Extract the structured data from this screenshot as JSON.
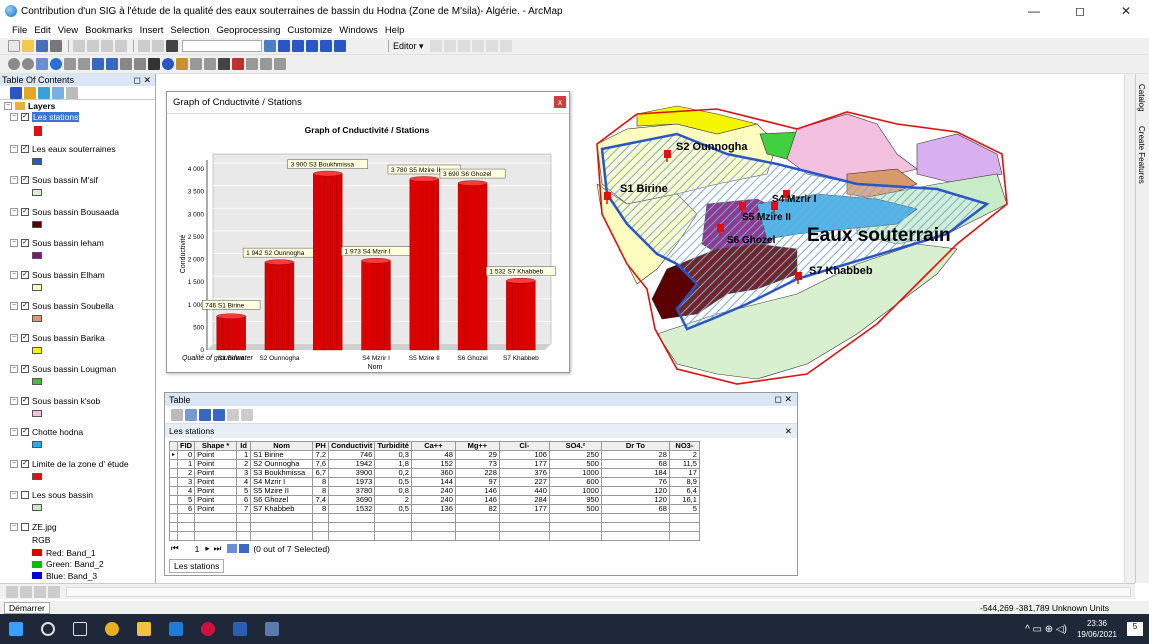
{
  "window": {
    "title": "Contribution d'un SIG à l'étude de la qualité des eaux souterraines de bassin du Hodna (Zone de M'sila)- Algérie. - ArcMap",
    "min": "—",
    "max": "◻",
    "close": "✕"
  },
  "menu": [
    "File",
    "Edit",
    "View",
    "Bookmarks",
    "Insert",
    "Selection",
    "Geoprocessing",
    "Customize",
    "Windows",
    "Help"
  ],
  "editor_label": "Editor ▾",
  "toc": {
    "title": "Table Of Contents",
    "pin": "◻ ✕",
    "root": "Layers",
    "layers": [
      {
        "name": "Les stations",
        "color": "#e01010",
        "checked": true,
        "selected": true
      },
      {
        "name": "Les eaux souterraines",
        "color": "#2a56c6",
        "checked": true
      },
      {
        "name": "Sous bassin M'sif",
        "color": "#d8f0d0",
        "checked": true
      },
      {
        "name": "Sous bassin Bousaada",
        "color": "#5a0000",
        "checked": true
      },
      {
        "name": "Sous bassin leham",
        "color": "#7a1a7a",
        "checked": true
      },
      {
        "name": "Sous bassin Elham",
        "color": "#fdfdc0",
        "checked": true
      },
      {
        "name": "Sous bassin Soubella",
        "color": "#d89a6a",
        "checked": true
      },
      {
        "name": "Sous bassin Barika",
        "color": "#f5f500",
        "checked": true
      },
      {
        "name": "Sous bassin Lougman",
        "color": "#40c040",
        "checked": true
      },
      {
        "name": "Sous bassin k'sob",
        "color": "#f4c0e0",
        "checked": true
      },
      {
        "name": "Chotte hodna",
        "color": "#30a8e0",
        "checked": true
      },
      {
        "name": "Limite de la zone d' étude",
        "color": "#e01010",
        "checked": true
      },
      {
        "name": "Les sous bassin",
        "color": "#c8ecc8",
        "checked": false
      },
      {
        "name": "ZE.jpg",
        "color": "",
        "checked": false
      }
    ],
    "raster": {
      "label": "RGB",
      "bands": [
        {
          "name": "Red:  Band_1",
          "color": "#e00000"
        },
        {
          "name": "Green: Band_2",
          "color": "#00c000"
        },
        {
          "name": "Blue:  Band_3",
          "color": "#0000e0"
        }
      ]
    }
  },
  "graph": {
    "window_title": "Graph of Cnductivité /  Stations",
    "close": "x",
    "footer": "Qualité of groundwater"
  },
  "chart_data": {
    "type": "bar",
    "title": "Graph of Cnductivité /  Stations",
    "xlabel": "Nom",
    "ylabel": "Conductivité",
    "ylim": [
      0,
      4000
    ],
    "yticks": [
      "0",
      "500",
      "1 000",
      "1 500",
      "2 000",
      "2 500",
      "3 000",
      "3 500",
      "4 000"
    ],
    "categories": [
      "S1 Birine",
      "S2 Ounnogha",
      "S3 Boukhmissa",
      "S4 Mzrir I",
      "S5 Mzire II",
      "S6 Ghozel",
      "S7 Khabbeb"
    ],
    "xtick_labels": [
      "S1 Birine",
      "S2 Ounnogha",
      "",
      "S4 Mzrir I",
      "S5 Mzire II",
      "S6 Ghozel",
      "S7 Khabbeb"
    ],
    "values": [
      746,
      1942,
      3900,
      1973,
      3780,
      3690,
      1532
    ],
    "data_labels": [
      "746  S1 Birine",
      "1 942  S2 Ounnogha",
      "3 900  S3 Boukhmissa",
      "1 973  S4 Mzrir I",
      "3 780  S5 Mzire II",
      "3 690  S6 Ghozel",
      "1 532  S7 Khabbeb"
    ],
    "bar_color": "#dd0000",
    "grid": true
  },
  "map": {
    "labels": [
      "S2 Ounnogha",
      "S1 Birine",
      "S4 Mzrir I",
      "S5 Mzire II",
      "S6 Ghozel",
      "Eaux souterrain",
      "S7 Khabbeb"
    ]
  },
  "table": {
    "window_title": "Table",
    "layer_tab": "Les stations",
    "columns": [
      "FID",
      "Shape *",
      "Id",
      "Nom",
      "PH",
      "Conductivit",
      "Turbidité",
      "Ca++",
      "Mg++",
      "Cl-",
      "SO4.²",
      "Dr To",
      "NO3-"
    ],
    "rows": [
      [
        "0",
        "Point",
        "1",
        "S1 Birine",
        "7,2",
        "746",
        "0,3",
        "48",
        "29",
        "106",
        "250",
        "28",
        "2"
      ],
      [
        "1",
        "Point",
        "2",
        "S2 Ounnogha",
        "7,6",
        "1942",
        "1,8",
        "152",
        "73",
        "177",
        "500",
        "68",
        "11,5"
      ],
      [
        "2",
        "Point",
        "3",
        "S3 Boukhmissa",
        "6,7",
        "3900",
        "0,2",
        "360",
        "228",
        "376",
        "1000",
        "184",
        "17"
      ],
      [
        "3",
        "Point",
        "4",
        "S4 Mzrir I",
        "8",
        "1973",
        "0,5",
        "144",
        "97",
        "227",
        "600",
        "76",
        "8,9"
      ],
      [
        "4",
        "Point",
        "5",
        "S5 Mzire II",
        "8",
        "3780",
        "0,8",
        "240",
        "146",
        "440",
        "1000",
        "120",
        "6,4"
      ],
      [
        "5",
        "Point",
        "6",
        "S6 Ghozel",
        "7,4",
        "3690",
        "2",
        "240",
        "146",
        "284",
        "950",
        "120",
        "16,1"
      ],
      [
        "6",
        "Point",
        "7",
        "S7 Khabbeb",
        "8",
        "1532",
        "0,5",
        "136",
        "82",
        "177",
        "500",
        "68",
        "5"
      ]
    ],
    "nav": "1",
    "selection": "(0 out of 7 Selected)",
    "bottom_tab": "Les stations"
  },
  "side_tabs": [
    "Catalog",
    "Create Features"
  ],
  "status": {
    "button": "Démarrer",
    "coords": "-544,269  -381,789 Unknown Units"
  },
  "taskbar": {
    "time": "23:36",
    "date": "19/06/2021",
    "notif": "5"
  }
}
